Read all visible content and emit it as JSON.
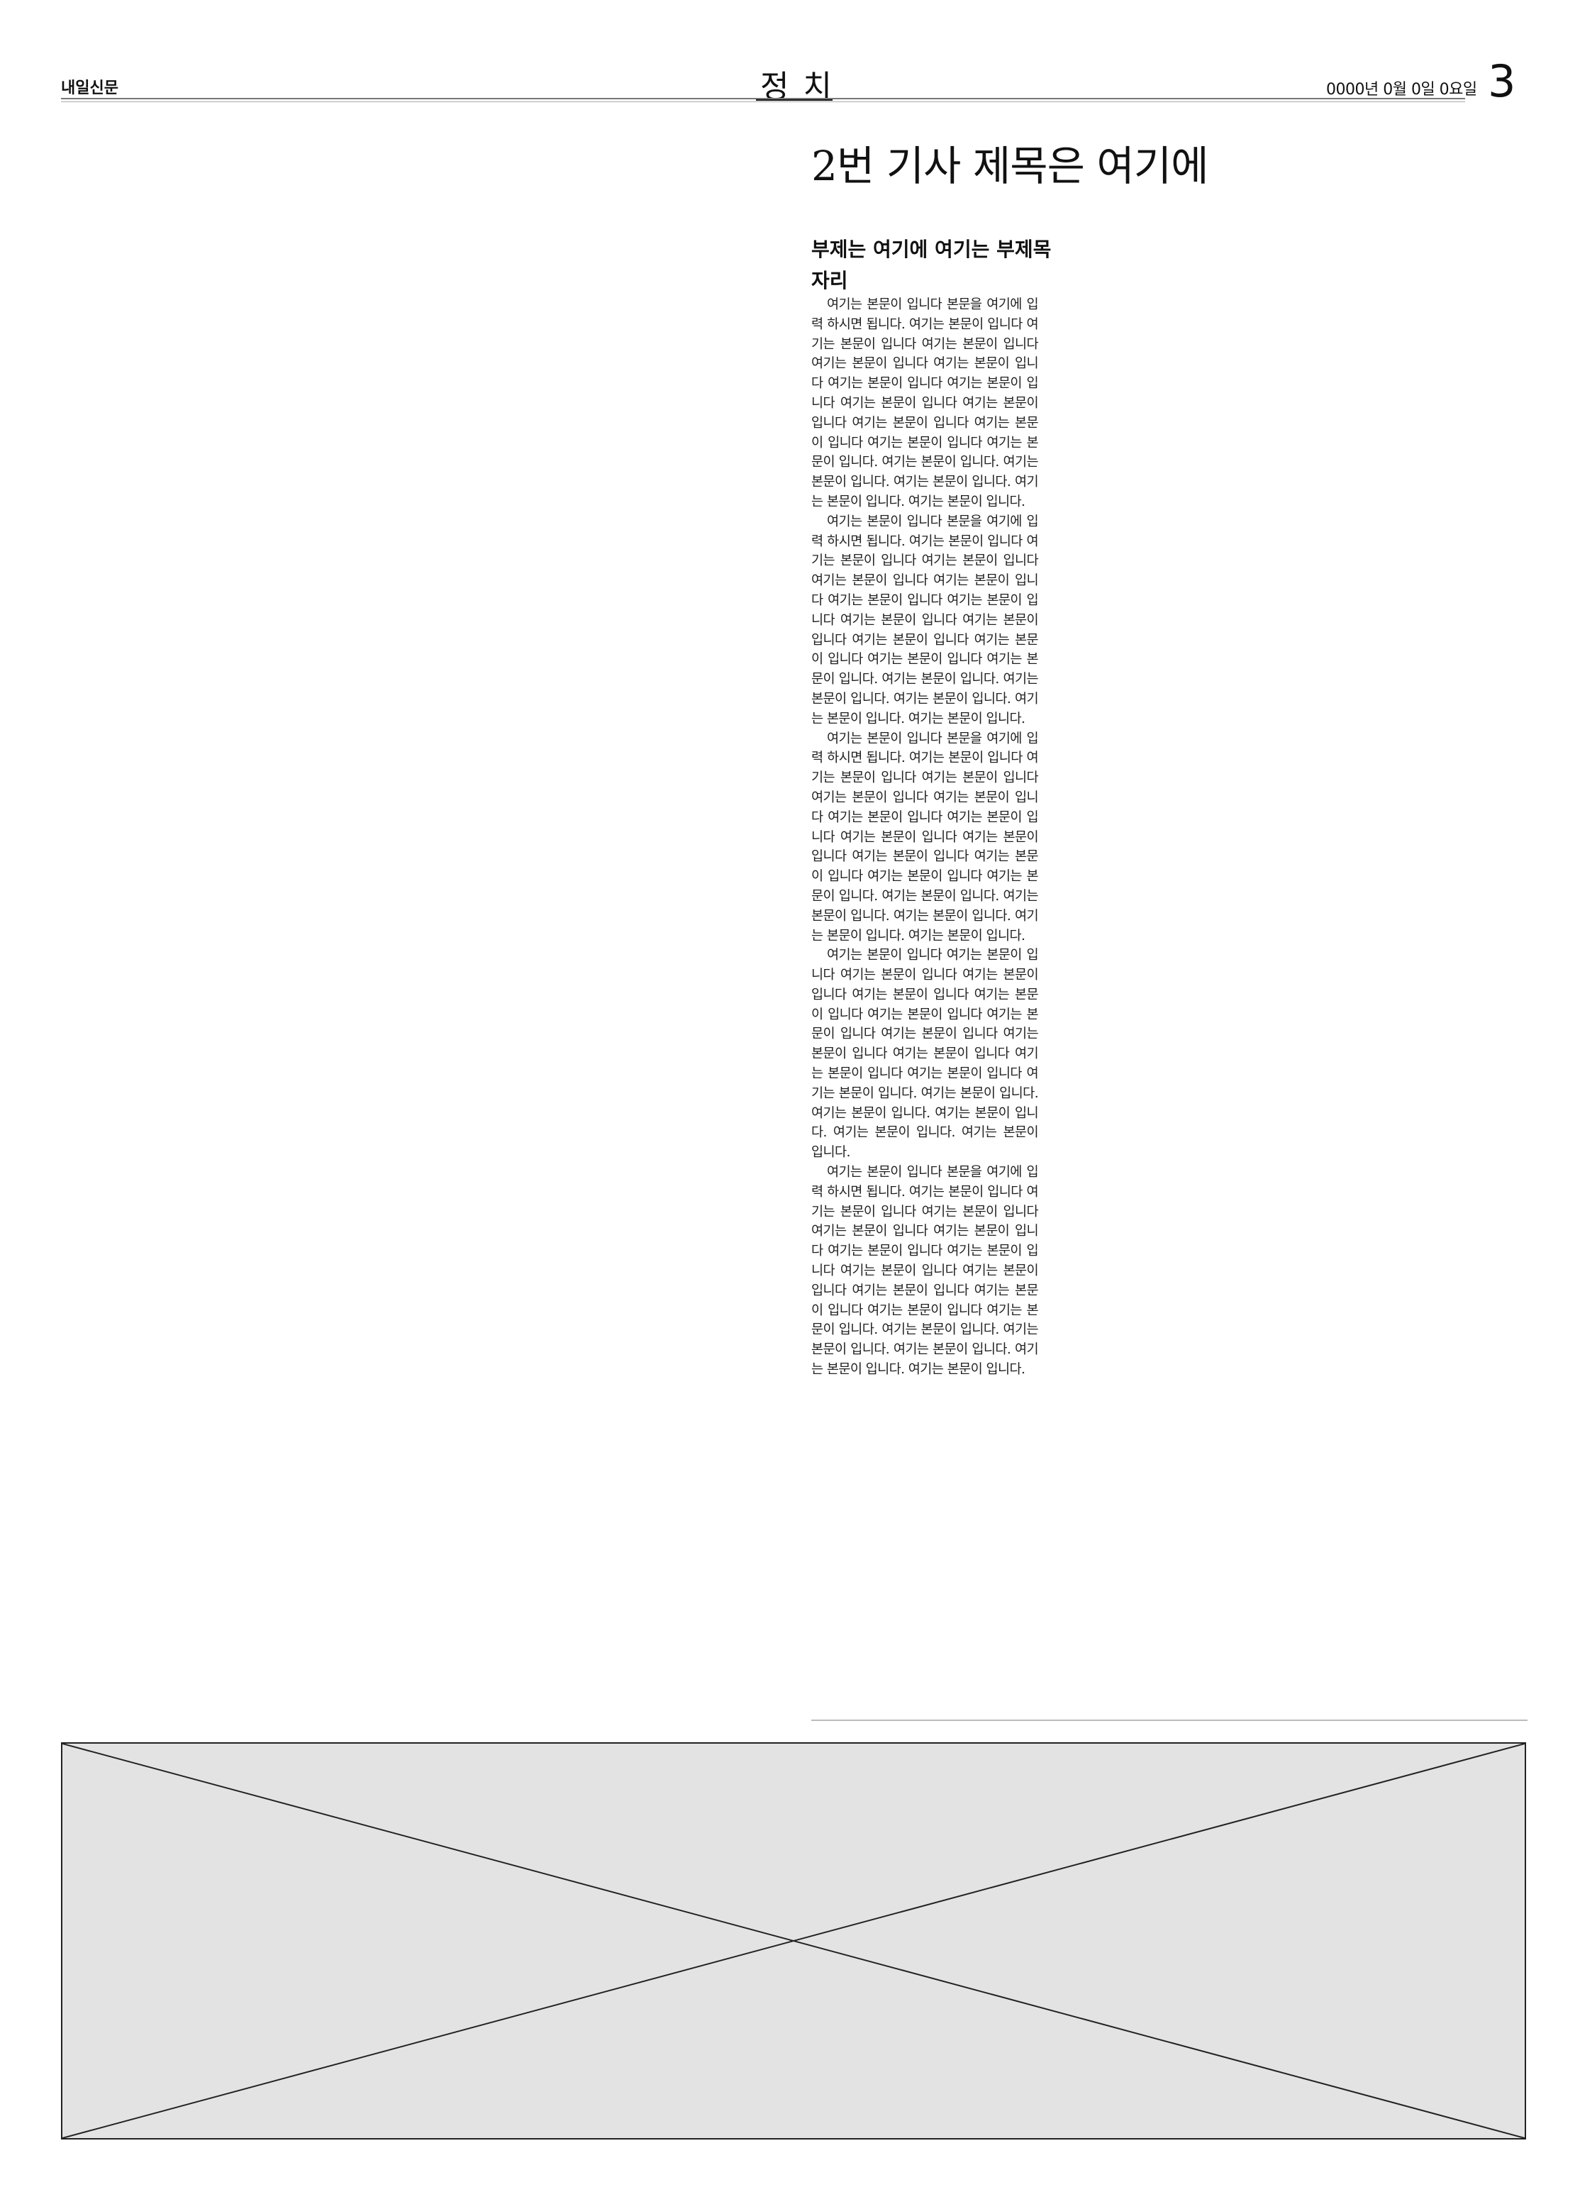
{
  "header": {
    "newspaper_name": "내일신문",
    "section": "정치",
    "date": "0000년 0월 0일 0요일",
    "page_number": "3"
  },
  "article": {
    "headline": "2번 기사 제목은 여기에",
    "subhead": "부제는 여기에 여기는 부제목 자리",
    "paragraphs": [
      "여기는 본문이 입니다 본문을 여기에 입력 하시면 됩니다. 여기는 본문이 입니다 여기는 본문이 입니다 여기는 본문이 입니다 여기는 본문이 입니다 여기는 본문이 입니다 여기는 본문이 입니다 여기는 본문이 입니다 여기는 본문이 입니다 여기는 본문이 입니다 여기는 본문이 입니다 여기는 본문이 입니다 여기는 본문이 입니다 여기는 본문이 입니다. 여기는 본문이 입니다. 여기는 본문이 입니다. 여기는 본문이 입니다. 여기는 본문이 입니다. 여기는 본문이 입니다.",
      "여기는 본문이 입니다 본문을 여기에 입력 하시면 됩니다. 여기는 본문이 입니다 여기는 본문이 입니다 여기는 본문이 입니다 여기는 본문이 입니다 여기는 본문이 입니다 여기는 본문이 입니다 여기는 본문이 입니다 여기는 본문이 입니다 여기는 본문이 입니다 여기는 본문이 입니다 여기는 본문이 입니다 여기는 본문이 입니다 여기는 본문이 입니다. 여기는 본문이 입니다. 여기는 본문이 입니다. 여기는 본문이 입니다. 여기는 본문이 입니다. 여기는 본문이 입니다.",
      "여기는 본문이 입니다 본문을 여기에 입력 하시면 됩니다. 여기는 본문이 입니다 여기는 본문이 입니다 여기는 본문이 입니다 여기는 본문이 입니다 여기는 본문이 입니다 여기는 본문이 입니다 여기는 본문이 입니다 여기는 본문이 입니다 여기는 본문이 입니다 여기는 본문이 입니다 여기는 본문이 입니다 여기는 본문이 입니다 여기는 본문이 입니다. 여기는 본문이 입니다. 여기는 본문이 입니다. 여기는 본문이 입니다. 여기는 본문이 입니다. 여기는 본문이 입니다.",
      "여기는 본문이 입니다 여기는 본문이 입니다 여기는 본문이 입니다 여기는 본문이 입니다 여기는 본문이 입니다 여기는 본문이 입니다 여기는 본문이 입니다 여기는 본문이 입니다 여기는 본문이 입니다 여기는 본문이 입니다 여기는 본문이 입니다 여기는 본문이 입니다 여기는 본문이 입니다 여기는 본문이 입니다. 여기는 본문이 입니다. 여기는 본문이 입니다. 여기는 본문이 입니다. 여기는 본문이 입니다. 여기는 본문이 입니다.",
      "여기는 본문이 입니다 본문을 여기에 입력 하시면 됩니다. 여기는 본문이 입니다 여기는 본문이 입니다 여기는 본문이 입니다 여기는 본문이 입니다 여기는 본문이 입니다 여기는 본문이 입니다 여기는 본문이 입니다 여기는 본문이 입니다 여기는 본문이 입니다 여기는 본문이 입니다 여기는 본문이 입니다 여기는 본문이 입니다 여기는 본문이 입니다. 여기는 본문이 입니다. 여기는 본문이 입니다. 여기는 본문이 입니다. 여기는 본문이 입니다. 여기는 본문이 입니다."
    ]
  },
  "colors": {
    "ad_placeholder_fill": "#e3e3e3",
    "ad_placeholder_border": "#222222"
  }
}
